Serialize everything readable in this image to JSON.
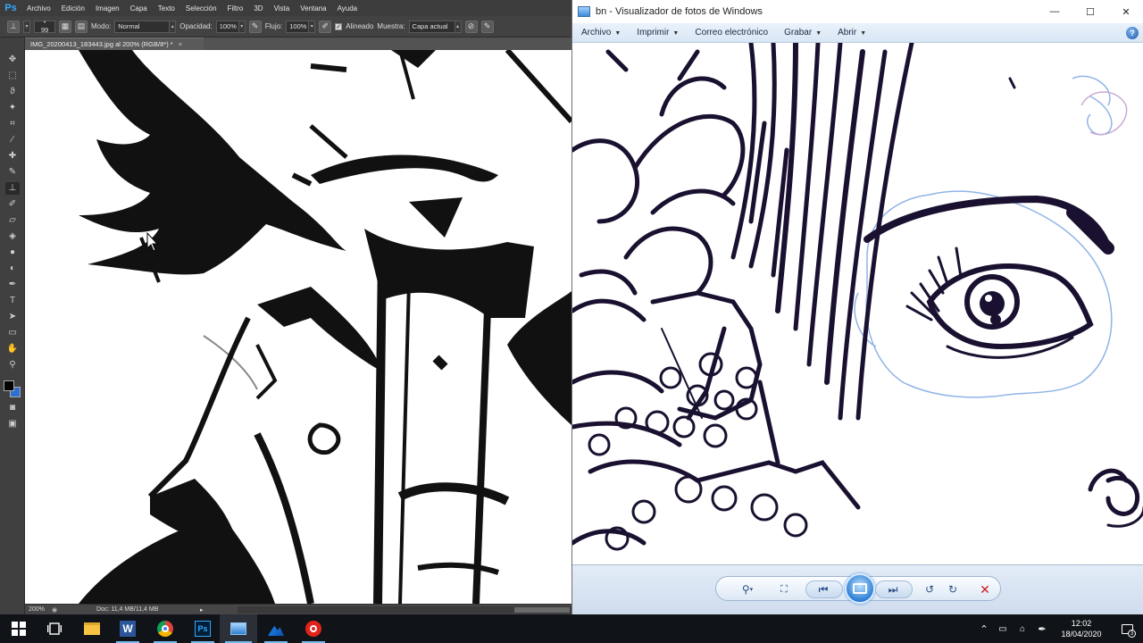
{
  "photoshop": {
    "logo": "Ps",
    "menu": [
      "Archivo",
      "Edición",
      "Imagen",
      "Capa",
      "Texto",
      "Selección",
      "Filtro",
      "3D",
      "Vista",
      "Ventana",
      "Ayuda"
    ],
    "options": {
      "brush_size": "99",
      "mode_label": "Modo:",
      "mode_value": "Normal",
      "opacity_label": "Opacidad:",
      "opacity_value": "100%",
      "flow_label": "Flujo:",
      "flow_value": "100%",
      "aligned_label": "Alineado",
      "sample_label": "Muestra:",
      "sample_value": "Capa actual"
    },
    "document_tab": "IMG_20200413_183443.jpg al 200% (RGB/8*) *",
    "document_tab_close": "×",
    "status": {
      "zoom": "200%",
      "doc_info": "Doc: 11,4 MB/11,4 MB"
    },
    "colors": {
      "foreground": "#000000",
      "background": "#2f6fd1"
    }
  },
  "viewer": {
    "title": "bn - Visualizador de fotos de Windows",
    "menu": [
      "Archivo",
      "Imprimir",
      "Correo electrónico",
      "Grabar",
      "Abrir"
    ],
    "help": "?"
  },
  "taskbar": {
    "time": "12:02",
    "date": "18/04/2020",
    "notification_count": "3"
  }
}
